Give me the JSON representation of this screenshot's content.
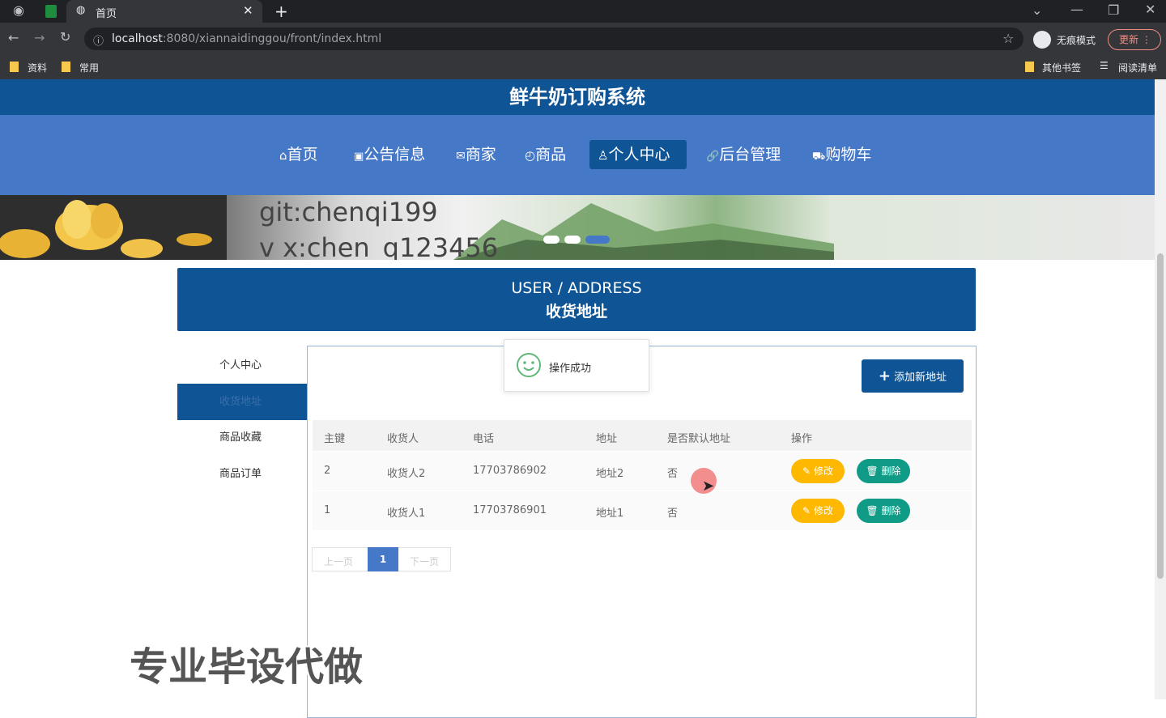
{
  "browser": {
    "tab_title": "首页",
    "url_host": "localhost",
    "url_rest": ":8080/xiannaidinggou/front/index.html",
    "profile_label": "无痕模式",
    "update_label": "更新",
    "bookmarks": [
      "资料",
      "常用"
    ],
    "bookmarks_right": [
      "其他书签",
      "阅读清单"
    ]
  },
  "header": {
    "title": "鲜牛奶订购系统"
  },
  "nav": {
    "items": [
      {
        "icon": "⌂",
        "label": "首页"
      },
      {
        "icon": "▣",
        "label": "公告信息"
      },
      {
        "icon": "✉",
        "label": "商家"
      },
      {
        "icon": "◴",
        "label": "商品"
      },
      {
        "icon": "♙",
        "label": "个人中心"
      },
      {
        "icon": "🔗",
        "label": "后台管理"
      },
      {
        "icon": "⛟",
        "label": "购物车"
      }
    ],
    "active_index": 4
  },
  "banner": {
    "line1": "git:chenqi199",
    "line2": "v x:chen_q123456"
  },
  "section": {
    "title_en": "USER / ADDRESS",
    "title_cn": "收货地址"
  },
  "sidebar": {
    "items": [
      "个人中心",
      "收货地址",
      "商品收藏",
      "商品订单"
    ],
    "active_index": 1
  },
  "toast": {
    "message": "操作成功"
  },
  "add_button": {
    "label": "添加新地址"
  },
  "table": {
    "columns": [
      "主键",
      "收货人",
      "电话",
      "地址",
      "是否默认地址",
      "操作"
    ],
    "rows": [
      {
        "id": "2",
        "name": "收货人2",
        "phone": "17703786902",
        "address": "地址2",
        "is_default": "否"
      },
      {
        "id": "1",
        "name": "收货人1",
        "phone": "17703786901",
        "address": "地址1",
        "is_default": "否"
      }
    ],
    "edit_label": "修改",
    "delete_label": "删除"
  },
  "pagination": {
    "prev": "上一页",
    "current": "1",
    "next": "下一页"
  },
  "watermark": {
    "text": "专业毕设代做"
  },
  "colors": {
    "primary": "#0f5596",
    "nav": "#4678c8",
    "edit": "#ffb800",
    "delete": "#0f9b85",
    "success": "#5fb878"
  }
}
